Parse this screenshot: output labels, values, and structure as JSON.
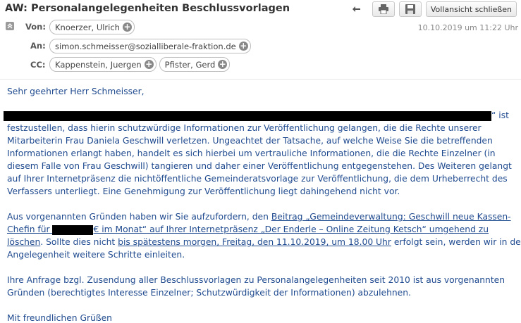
{
  "header": {
    "subject": "AW: Personalangelegenheiten Beschlussvorlagen",
    "close_full_view_label": "Vollansicht schließen",
    "date": "10.10.2019 um 11:22 Uhr",
    "from_label": "Von:",
    "to_label": "An:",
    "cc_label": "CC:",
    "from": [
      "Knoerzer, Ulrich"
    ],
    "to": [
      "simon.schmeisser@sozialliberale-fraktion.de"
    ],
    "cc": [
      "Kappenstein, Juergen",
      "Pfister, Gerd"
    ]
  },
  "body": {
    "greeting": "Sehr geehrter Herr Schmeisser,",
    "p1_line1_end": "“ ist",
    "p1_lines": [
      "festzustellen, dass hierin schutzwürdige Informationen zur Veröffentlichung gelangen, die die Rechte unserer",
      "Mitarbeiterin Frau Daniela Geschwill verletzen. Ungeachtet der Tatsache, auf welche Weise Sie die betreffenden",
      "Informationen erlangt haben, handelt es sich hierbei um vertrauliche Informationen, die die Rechte Einzelner (in",
      "diesem Falle von Frau Geschwill) tangieren und daher einer Veröffentlichung entgegenstehen. Des Weiteren gelangt",
      "auf Ihrer Internetpräsenz die nichtöffentliche Gemeinderatsvorlage zur Veröffentlichung, die dem Urheberrecht des",
      "Verfassers unterliegt. Eine Genehmigung zur Veröffentlichung liegt dahingehend nicht vor."
    ],
    "p2_l1_a": "Aus vorgenannten Gründen haben wir Sie aufzufordern, den ",
    "p2_l1_link": "Beitrag „Gemeindeverwaltung: Geschwill neue Kassen-",
    "p2_l2_a": "Chefin für ",
    "p2_l2_b": "€ im Monat“ auf Ihrer Internetpräsenz „Der Enderle – Online Zeitung Ketsch“ umgehend zu",
    "p2_l3_link": "löschen",
    "p2_l3_b": ". Sollte dies nicht ",
    "p2_l3_link2": "bis spätestens morgen, Freitag, den 11.10.2019, um 18.00 Uhr",
    "p2_l3_c": " erfolgt sein, werden wir in der",
    "p2_l4": "Angelegenheit weitere Schritte einleiten.",
    "p3_lines": [
      "Ihre Anfrage bzgl. Zusendung aller Beschlussvorlagen zu Personalangelegenheiten seit 2010 ist aus vorgenannten",
      "Gründen (berechtigtes Interesse Einzelner; Schutzwürdigkeit der Informationen) abzulehnen."
    ],
    "closing_partial": "Mit freundlichen Grüßen"
  }
}
